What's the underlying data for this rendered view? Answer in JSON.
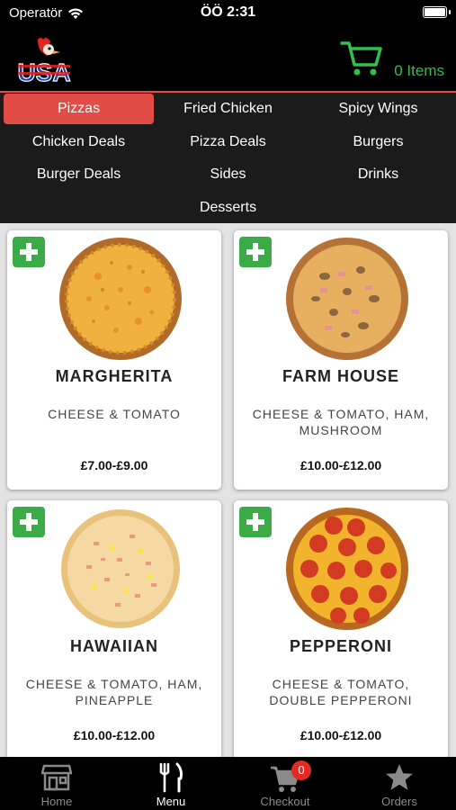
{
  "status_bar": {
    "carrier": "Operatör",
    "time": "ÖÖ 2:31"
  },
  "header": {
    "logo_text": "USA",
    "cart_label": "0 Items"
  },
  "categories": {
    "active": "Pizzas",
    "items": [
      "Pizzas",
      "Fried Chicken",
      "Spicy Wings",
      "Chicken Deals",
      "Pizza Deals",
      "Burgers",
      "Burger Deals",
      "Sides",
      "Drinks",
      "Desserts"
    ]
  },
  "products": [
    {
      "name": "MARGHERITA",
      "desc": "CHEESE & TOMATO",
      "price": "£7.00-£9.00"
    },
    {
      "name": "FARM HOUSE",
      "desc": "CHEESE & TOMATO, HAM, MUSHROOM",
      "price": "£10.00-£12.00"
    },
    {
      "name": "HAWAIIAN",
      "desc": "CHEESE & TOMATO, HAM, PINEAPPLE",
      "price": "£10.00-£12.00"
    },
    {
      "name": "PEPPERONI",
      "desc": "CHEESE & TOMATO, DOUBLE PEPPERONI",
      "price": "£10.00-£12.00"
    }
  ],
  "tabs": [
    {
      "label": "Home",
      "icon": "store-icon",
      "active": false
    },
    {
      "label": "Menu",
      "icon": "fork-knife-icon",
      "active": true
    },
    {
      "label": "Checkout",
      "icon": "cart-icon",
      "active": false,
      "badge": "0"
    },
    {
      "label": "Orders",
      "icon": "star-icon",
      "active": false
    }
  ],
  "colors": {
    "accent_red": "#e14c46",
    "cart_green": "#2fc14a",
    "add_green": "#3aab47",
    "badge_red": "#e12b24"
  }
}
